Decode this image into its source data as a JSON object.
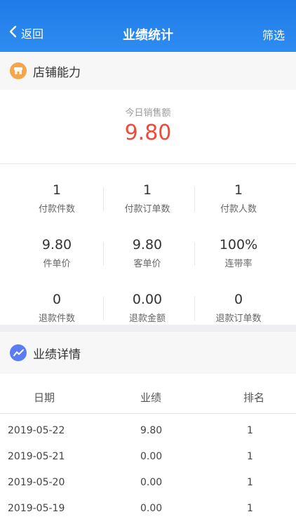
{
  "header": {
    "back_label": "返回",
    "title": "业绩统计",
    "filter_label": "筛选",
    "bg_color": "#2d8cf0"
  },
  "store_section": {
    "title": "店铺能力",
    "icon": "store-icon",
    "icon_color": "#f5a54a"
  },
  "today_sales": {
    "label": "今日销售额",
    "value": "9.80",
    "value_color": "#ef4a3c"
  },
  "metrics": [
    {
      "value": "1",
      "label": "付款件数"
    },
    {
      "value": "1",
      "label": "付款订单数"
    },
    {
      "value": "1",
      "label": "付款人数"
    },
    {
      "value": "9.80",
      "label": "件单价"
    },
    {
      "value": "9.80",
      "label": "客单价"
    },
    {
      "value": "100%",
      "label": "连带率"
    },
    {
      "value": "0",
      "label": "退款件数"
    },
    {
      "value": "0.00",
      "label": "退款金额"
    },
    {
      "value": "0",
      "label": "退款订单数"
    }
  ],
  "detail_section": {
    "title": "业绩详情",
    "icon": "trend-chart-icon",
    "icon_color": "#5b7cf5"
  },
  "table": {
    "headers": [
      "日期",
      "业绩",
      "排名"
    ],
    "rows": [
      [
        "2019-05-22",
        "9.80",
        "1"
      ],
      [
        "2019-05-21",
        "0.00",
        "1"
      ],
      [
        "2019-05-20",
        "0.00",
        "1"
      ],
      [
        "2019-05-19",
        "0.00",
        "1"
      ]
    ]
  }
}
